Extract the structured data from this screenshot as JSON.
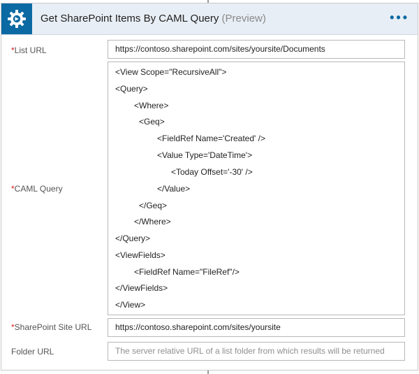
{
  "header": {
    "icon": "sharepoint-gear-icon",
    "title": "Get SharePoint Items By CAML Query",
    "tag": "(Preview)",
    "menu_label": "•••",
    "accent": "#0b6aa3"
  },
  "fields": {
    "list_url": {
      "required_mark": "*",
      "label": "List URL",
      "value": "https://contoso.sharepoint.com/sites/yoursite/Documents"
    },
    "caml_query": {
      "required_mark": "*",
      "label": "CAML Query",
      "lines": [
        "<View Scope=\"RecursiveAll\">",
        "<Query>",
        "<Where>",
        "<Geq>",
        "<FieldRef Name='Created' />",
        "<Value Type='DateTime'>",
        "<Today Offset='-30' />",
        "</Value>",
        "</Geq>",
        "</Where>",
        "</Query>",
        "<ViewFields>",
        "<FieldRef Name=\"FileRef\"/>",
        "</ViewFields>",
        "</View>"
      ]
    },
    "site_url": {
      "required_mark": "*",
      "label": "SharePoint Site URL",
      "value": "https://contoso.sharepoint.com/sites/yoursite"
    },
    "folder_url": {
      "label": "Folder URL",
      "placeholder": "The server relative URL of a list folder from which results will be returned"
    }
  }
}
